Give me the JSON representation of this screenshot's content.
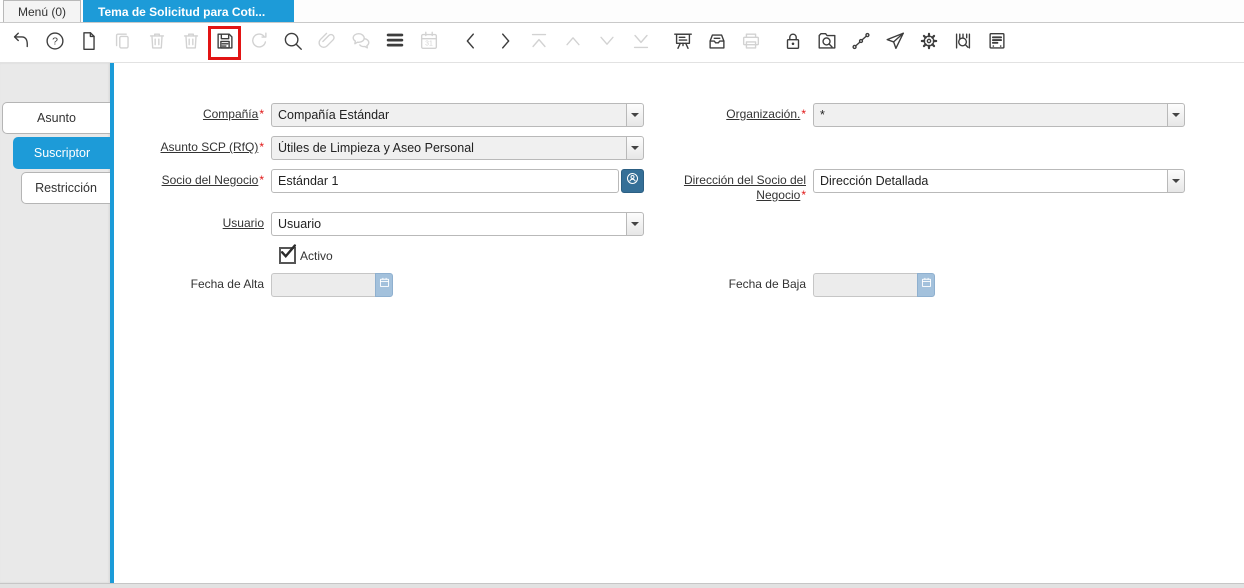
{
  "window": {
    "tabs": [
      {
        "label": "Menú (0)",
        "active": false
      },
      {
        "label": "Tema de Solicitud para Coti...",
        "active": true,
        "closable": true
      }
    ]
  },
  "toolbar": {
    "help_glyph": "?",
    "calendar_glyph": "31",
    "highlighted_button": "save",
    "buttons": [
      {
        "icon": "undo-icon",
        "enabled": true
      },
      {
        "icon": "help-icon",
        "enabled": true
      },
      {
        "icon": "new-record-icon",
        "enabled": true
      },
      {
        "icon": "copy-record-icon",
        "enabled": false
      },
      {
        "icon": "delete-record-icon",
        "enabled": false
      },
      {
        "icon": "delete-selection-icon",
        "enabled": false
      },
      {
        "icon": "save-icon",
        "enabled": true,
        "highlighted": true
      },
      {
        "icon": "refresh-icon",
        "enabled": false
      },
      {
        "icon": "find-icon",
        "enabled": true
      },
      {
        "icon": "attachment-icon",
        "enabled": false
      },
      {
        "icon": "chat-icon",
        "enabled": false
      },
      {
        "icon": "grid-toggle-icon",
        "enabled": true
      },
      {
        "icon": "calendar-icon",
        "enabled": false
      },
      {
        "icon": "previous-record-icon",
        "enabled": true
      },
      {
        "icon": "next-record-icon",
        "enabled": true
      },
      {
        "icon": "first-record-icon",
        "enabled": false
      },
      {
        "icon": "parent-record-icon",
        "enabled": false
      },
      {
        "icon": "detail-record-icon",
        "enabled": false
      },
      {
        "icon": "last-record-icon",
        "enabled": false
      },
      {
        "icon": "report-icon",
        "enabled": true
      },
      {
        "icon": "archive-icon",
        "enabled": true
      },
      {
        "icon": "print-icon",
        "enabled": false
      },
      {
        "icon": "lock-icon",
        "enabled": true
      },
      {
        "icon": "zoom-across-icon",
        "enabled": true
      },
      {
        "icon": "workflow-icon",
        "enabled": true
      },
      {
        "icon": "requests-icon",
        "enabled": true
      },
      {
        "icon": "process-icon",
        "enabled": true
      },
      {
        "icon": "product-info-icon",
        "enabled": true
      },
      {
        "icon": "quick-form-icon",
        "enabled": true
      }
    ]
  },
  "sidebar": {
    "tabs": [
      {
        "label": "Asunto",
        "active": false,
        "level": 0
      },
      {
        "label": "Suscriptor",
        "active": true,
        "level": 1
      },
      {
        "label": "Restricción",
        "active": false,
        "level": 2
      }
    ]
  },
  "form": {
    "compania": {
      "label": "Compañía",
      "required": "*",
      "value": "Compañía Estándar"
    },
    "organizacion": {
      "label": "Organización.",
      "required": "*",
      "value": "*"
    },
    "asunto": {
      "label": "Asunto SCP (RfQ)",
      "required": "*",
      "value": "Útiles de Limpieza y Aseo Personal"
    },
    "socio": {
      "label": "Socio del Negocio",
      "required": "*",
      "value": "Estándar 1"
    },
    "direccion": {
      "label": "Dirección del Socio del Negocio",
      "required": "*",
      "value": "Dirección Detallada"
    },
    "usuario": {
      "label": "Usuario",
      "value": "Usuario"
    },
    "activo": {
      "label": "Activo",
      "checked": true
    },
    "fecha_alta": {
      "label": "Fecha de Alta",
      "value": ""
    },
    "fecha_baja": {
      "label": "Fecha de Baja",
      "value": ""
    }
  },
  "colors": {
    "accent_blue": "#1d9bd8",
    "highlight_red": "#e21414",
    "bp_button_blue": "#356f97",
    "calendar_button_blue": "#a3c1dc"
  }
}
